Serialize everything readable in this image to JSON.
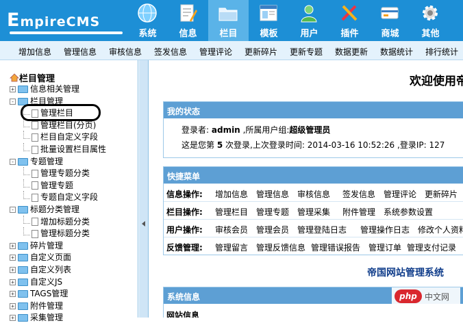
{
  "header": {
    "logo_prefix": "E",
    "logo_rest": "mpireCMS",
    "nav": [
      {
        "label": "系统",
        "icon": "globe-icon"
      },
      {
        "label": "信息",
        "icon": "document-pencil-icon"
      },
      {
        "label": "栏目",
        "icon": "folder-icon",
        "active": true
      },
      {
        "label": "模板",
        "icon": "template-window-icon"
      },
      {
        "label": "用户",
        "icon": "user-icon"
      },
      {
        "label": "插件",
        "icon": "plugin-tools-icon"
      },
      {
        "label": "商城",
        "icon": "shop-card-icon"
      },
      {
        "label": "其他",
        "icon": "gear-icon"
      }
    ],
    "brand_color": "#1d8fd6"
  },
  "submenu": [
    "增加信息",
    "管理信息",
    "审核信息",
    "签发信息",
    "管理评论",
    "更新碎片",
    "更新专题",
    "数据更新",
    "数据统计",
    "排行统计"
  ],
  "sidebar": {
    "title": "栏目管理",
    "tree": [
      {
        "label": "信息相关管理",
        "kind": "folder",
        "pm": "+",
        "level": 0
      },
      {
        "label": "栏目管理",
        "kind": "folder",
        "pm": "-",
        "level": 0
      },
      {
        "label": "管理栏目",
        "kind": "doc",
        "level": 1,
        "highlighted": true
      },
      {
        "label": "管理栏目(分页)",
        "kind": "doc",
        "level": 1
      },
      {
        "label": "栏目自定义字段",
        "kind": "doc",
        "level": 1
      },
      {
        "label": "批量设置栏目属性",
        "kind": "doc",
        "level": 1
      },
      {
        "label": "专题管理",
        "kind": "folder",
        "pm": "-",
        "level": 0
      },
      {
        "label": "管理专题分类",
        "kind": "doc",
        "level": 1
      },
      {
        "label": "管理专题",
        "kind": "doc",
        "level": 1
      },
      {
        "label": "专题自定义字段",
        "kind": "doc",
        "level": 1
      },
      {
        "label": "标题分类管理",
        "kind": "folder",
        "pm": "-",
        "level": 0
      },
      {
        "label": "增加标题分类",
        "kind": "doc",
        "level": 1
      },
      {
        "label": "管理标题分类",
        "kind": "doc",
        "level": 1
      },
      {
        "label": "碎片管理",
        "kind": "folder",
        "pm": "+",
        "level": 0
      },
      {
        "label": "自定义页面",
        "kind": "folder",
        "pm": "+",
        "level": 0
      },
      {
        "label": "自定义列表",
        "kind": "folder",
        "pm": "+",
        "level": 0
      },
      {
        "label": "自定义JS",
        "kind": "folder",
        "pm": "+",
        "level": 0
      },
      {
        "label": "TAGS管理",
        "kind": "folder",
        "pm": "+",
        "level": 0
      },
      {
        "label": "附件管理",
        "kind": "folder",
        "pm": "+",
        "level": 0
      },
      {
        "label": "采集管理",
        "kind": "folder",
        "pm": "+",
        "level": 0
      }
    ]
  },
  "main": {
    "welcome": "欢迎使用帝",
    "status": {
      "title": "我的状态",
      "line1_prefix": "登录者:",
      "user": "admin",
      "line1_mid": ",所属用户组:",
      "group": "超级管理员",
      "line2_prefix": "这是您第",
      "login_count": "5",
      "line2_mid": "次登录,上次登录时间:",
      "last_login": "2014-03-16 10:52:26",
      "line2_ip_label": ",登录IP:",
      "ip": "127"
    },
    "quick": {
      "title": "快捷菜单",
      "rows": [
        {
          "cat": "信息操作:",
          "links": [
            "增加信息",
            "管理信息",
            "审核信息",
            "签发信息",
            "管理评论",
            "更新碎片"
          ]
        },
        {
          "cat": "栏目操作:",
          "links": [
            "管理栏目",
            "管理专题",
            "管理采集",
            "附件管理",
            "系统参数设置"
          ]
        },
        {
          "cat": "用户操作:",
          "links": [
            "审核会员",
            "管理会员",
            "管理登陆日志",
            "管理操作日志",
            "修改个人资料"
          ]
        },
        {
          "cat": "反馈管理:",
          "links": [
            "管理留言",
            "管理反馈信息",
            "管理错误报告",
            "管理订单",
            "管理支付记录"
          ]
        }
      ]
    },
    "footer_title": "帝国网站管理系统",
    "sysinfo": {
      "title": "系统信息",
      "sub": "网站信息"
    }
  },
  "badge": {
    "php": "php",
    "text": "中文网"
  }
}
